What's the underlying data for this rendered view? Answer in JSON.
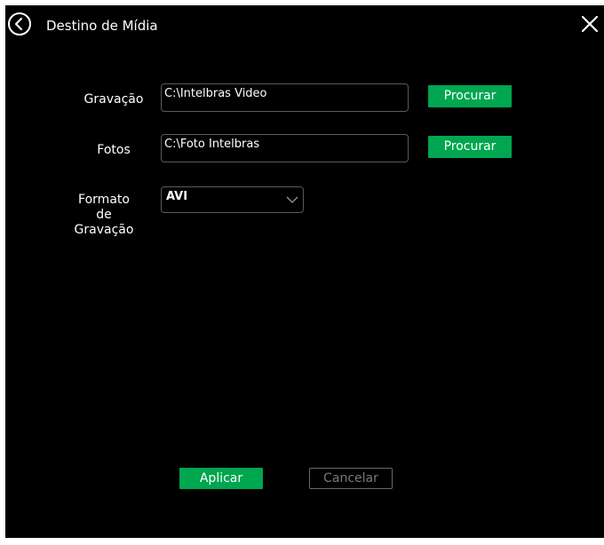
{
  "dialog": {
    "title": "Destino de Mídia",
    "back_icon": "back-circle-icon",
    "close_icon": "close-icon"
  },
  "recording": {
    "label": "Gravação",
    "path": "C:\\Intelbras Video",
    "browse_label": "Procurar"
  },
  "photos": {
    "label": "Fotos",
    "path": "C:\\Foto Intelbras",
    "browse_label": "Procurar"
  },
  "format": {
    "label_line1": "Formato",
    "label_line2": "de",
    "label_line3": "Gravação",
    "value": "AVI"
  },
  "actions": {
    "apply_label": "Aplicar",
    "cancel_label": "Cancelar"
  },
  "colors": {
    "background": "#000000",
    "accent_green": "#00a650",
    "text": "#ffffff",
    "disabled_text": "#7a7a7a"
  }
}
